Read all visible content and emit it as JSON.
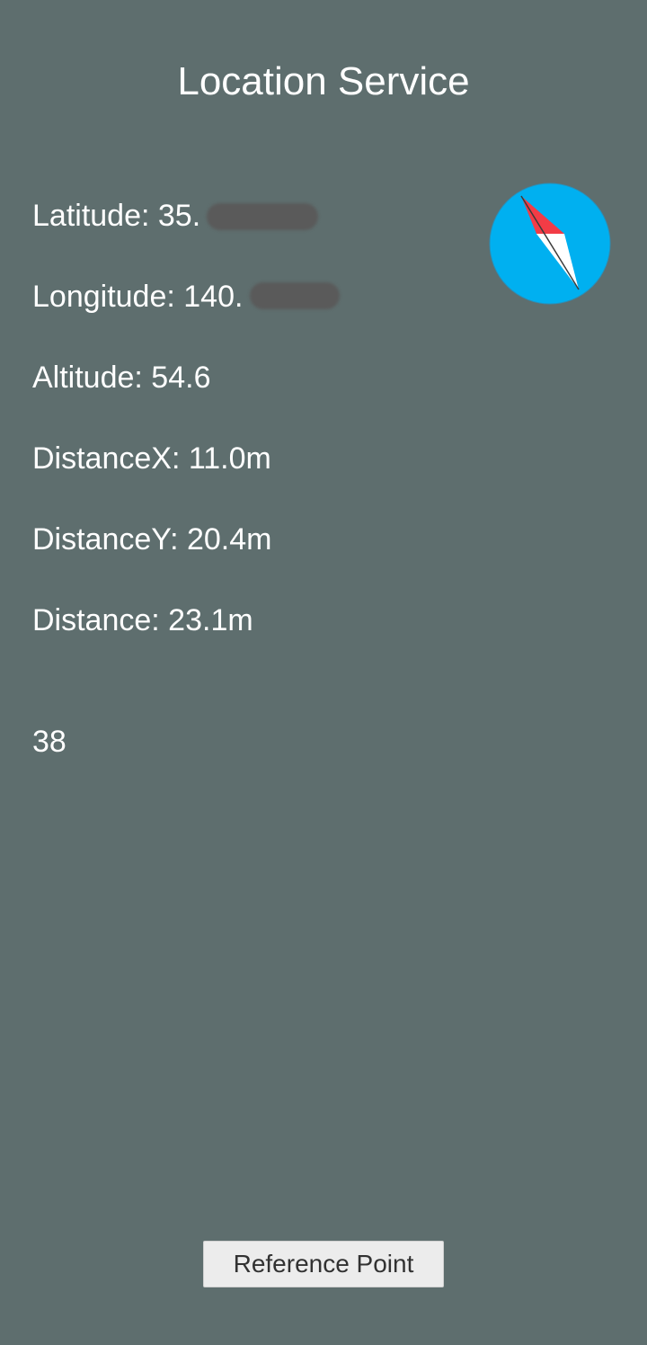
{
  "header": {
    "title": "Location Service"
  },
  "location": {
    "latitude": "Latitude: 35.",
    "longitude": "Longitude: 140.",
    "altitude": "Altitude: 54.6",
    "distance_x": "DistanceX: 11.0m",
    "distance_y": "DistanceY: 20.4m",
    "distance": "Distance: 23.1m",
    "heading_value": "38"
  },
  "compass": {
    "icon": "compass-icon",
    "face_color": "#00b0f0",
    "north_color": "#f23c46",
    "south_color": "#ffffff"
  },
  "actions": {
    "reference_point_label": "Reference Point"
  },
  "colors": {
    "background": "#5e6e6e",
    "text": "#ffffff",
    "button_bg": "#ececec",
    "button_text": "#323232"
  }
}
